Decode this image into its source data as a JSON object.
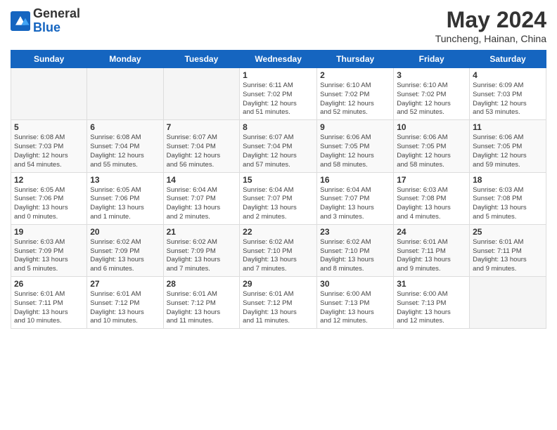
{
  "header": {
    "logo_general": "General",
    "logo_blue": "Blue",
    "month_title": "May 2024",
    "location": "Tuncheng, Hainan, China"
  },
  "weekdays": [
    "Sunday",
    "Monday",
    "Tuesday",
    "Wednesday",
    "Thursday",
    "Friday",
    "Saturday"
  ],
  "weeks": [
    [
      {
        "day": "",
        "info": ""
      },
      {
        "day": "",
        "info": ""
      },
      {
        "day": "",
        "info": ""
      },
      {
        "day": "1",
        "info": "Sunrise: 6:11 AM\nSunset: 7:02 PM\nDaylight: 12 hours\nand 51 minutes."
      },
      {
        "day": "2",
        "info": "Sunrise: 6:10 AM\nSunset: 7:02 PM\nDaylight: 12 hours\nand 52 minutes."
      },
      {
        "day": "3",
        "info": "Sunrise: 6:10 AM\nSunset: 7:02 PM\nDaylight: 12 hours\nand 52 minutes."
      },
      {
        "day": "4",
        "info": "Sunrise: 6:09 AM\nSunset: 7:03 PM\nDaylight: 12 hours\nand 53 minutes."
      }
    ],
    [
      {
        "day": "5",
        "info": "Sunrise: 6:08 AM\nSunset: 7:03 PM\nDaylight: 12 hours\nand 54 minutes."
      },
      {
        "day": "6",
        "info": "Sunrise: 6:08 AM\nSunset: 7:04 PM\nDaylight: 12 hours\nand 55 minutes."
      },
      {
        "day": "7",
        "info": "Sunrise: 6:07 AM\nSunset: 7:04 PM\nDaylight: 12 hours\nand 56 minutes."
      },
      {
        "day": "8",
        "info": "Sunrise: 6:07 AM\nSunset: 7:04 PM\nDaylight: 12 hours\nand 57 minutes."
      },
      {
        "day": "9",
        "info": "Sunrise: 6:06 AM\nSunset: 7:05 PM\nDaylight: 12 hours\nand 58 minutes."
      },
      {
        "day": "10",
        "info": "Sunrise: 6:06 AM\nSunset: 7:05 PM\nDaylight: 12 hours\nand 58 minutes."
      },
      {
        "day": "11",
        "info": "Sunrise: 6:06 AM\nSunset: 7:05 PM\nDaylight: 12 hours\nand 59 minutes."
      }
    ],
    [
      {
        "day": "12",
        "info": "Sunrise: 6:05 AM\nSunset: 7:06 PM\nDaylight: 13 hours\nand 0 minutes."
      },
      {
        "day": "13",
        "info": "Sunrise: 6:05 AM\nSunset: 7:06 PM\nDaylight: 13 hours\nand 1 minute."
      },
      {
        "day": "14",
        "info": "Sunrise: 6:04 AM\nSunset: 7:07 PM\nDaylight: 13 hours\nand 2 minutes."
      },
      {
        "day": "15",
        "info": "Sunrise: 6:04 AM\nSunset: 7:07 PM\nDaylight: 13 hours\nand 2 minutes."
      },
      {
        "day": "16",
        "info": "Sunrise: 6:04 AM\nSunset: 7:07 PM\nDaylight: 13 hours\nand 3 minutes."
      },
      {
        "day": "17",
        "info": "Sunrise: 6:03 AM\nSunset: 7:08 PM\nDaylight: 13 hours\nand 4 minutes."
      },
      {
        "day": "18",
        "info": "Sunrise: 6:03 AM\nSunset: 7:08 PM\nDaylight: 13 hours\nand 5 minutes."
      }
    ],
    [
      {
        "day": "19",
        "info": "Sunrise: 6:03 AM\nSunset: 7:09 PM\nDaylight: 13 hours\nand 5 minutes."
      },
      {
        "day": "20",
        "info": "Sunrise: 6:02 AM\nSunset: 7:09 PM\nDaylight: 13 hours\nand 6 minutes."
      },
      {
        "day": "21",
        "info": "Sunrise: 6:02 AM\nSunset: 7:09 PM\nDaylight: 13 hours\nand 7 minutes."
      },
      {
        "day": "22",
        "info": "Sunrise: 6:02 AM\nSunset: 7:10 PM\nDaylight: 13 hours\nand 7 minutes."
      },
      {
        "day": "23",
        "info": "Sunrise: 6:02 AM\nSunset: 7:10 PM\nDaylight: 13 hours\nand 8 minutes."
      },
      {
        "day": "24",
        "info": "Sunrise: 6:01 AM\nSunset: 7:11 PM\nDaylight: 13 hours\nand 9 minutes."
      },
      {
        "day": "25",
        "info": "Sunrise: 6:01 AM\nSunset: 7:11 PM\nDaylight: 13 hours\nand 9 minutes."
      }
    ],
    [
      {
        "day": "26",
        "info": "Sunrise: 6:01 AM\nSunset: 7:11 PM\nDaylight: 13 hours\nand 10 minutes."
      },
      {
        "day": "27",
        "info": "Sunrise: 6:01 AM\nSunset: 7:12 PM\nDaylight: 13 hours\nand 10 minutes."
      },
      {
        "day": "28",
        "info": "Sunrise: 6:01 AM\nSunset: 7:12 PM\nDaylight: 13 hours\nand 11 minutes."
      },
      {
        "day": "29",
        "info": "Sunrise: 6:01 AM\nSunset: 7:12 PM\nDaylight: 13 hours\nand 11 minutes."
      },
      {
        "day": "30",
        "info": "Sunrise: 6:00 AM\nSunset: 7:13 PM\nDaylight: 13 hours\nand 12 minutes."
      },
      {
        "day": "31",
        "info": "Sunrise: 6:00 AM\nSunset: 7:13 PM\nDaylight: 13 hours\nand 12 minutes."
      },
      {
        "day": "",
        "info": ""
      }
    ]
  ]
}
